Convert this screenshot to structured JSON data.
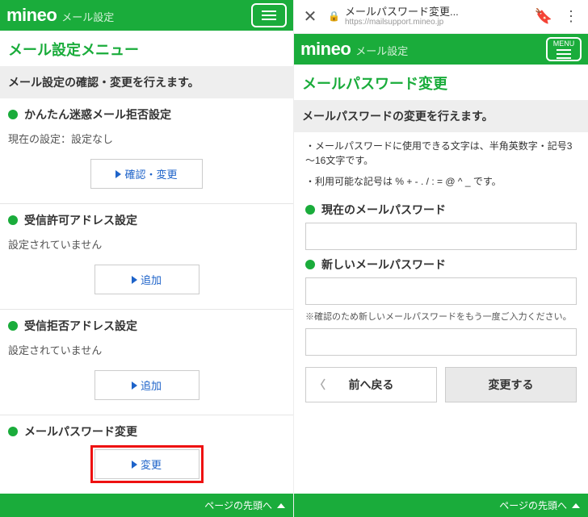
{
  "left": {
    "brand_logo": "mineo",
    "brand_sub": "メール設定",
    "page_title": "メール設定メニュー",
    "description": "メール設定の確認・変更を行えます。",
    "sections": [
      {
        "title": "かんたん迷惑メール拒否設定",
        "status": "現在の設定：設定なし",
        "button": "確認・変更"
      },
      {
        "title": "受信許可アドレス設定",
        "status": "設定されていません",
        "button": "追加"
      },
      {
        "title": "受信拒否アドレス設定",
        "status": "設定されていません",
        "button": "追加"
      },
      {
        "title": "メールパスワード変更",
        "status": "",
        "button": "変更"
      }
    ],
    "footer": "ページの先頭へ"
  },
  "right": {
    "browser_title": "メールパスワード変更...",
    "browser_url": "https://mailsupport.mineo.jp",
    "menu_label": "MENU",
    "brand_logo": "mineo",
    "brand_sub": "メール設定",
    "page_title": "メールパスワード変更",
    "description": "メールパスワードの変更を行えます。",
    "note1": "・メールパスワードに使用できる文字は、半角英数字・記号3～16文字です。",
    "note2": "・利用可能な記号は % + - . / : = @ ^ _ です。",
    "field_current": "現在のメールパスワード",
    "field_new": "新しいメールパスワード",
    "hint_confirm": "※確認のため新しいメールパスワードをもう一度ご入力ください。",
    "btn_back": "前へ戻る",
    "btn_submit": "変更する",
    "footer": "ページの先頭へ"
  }
}
